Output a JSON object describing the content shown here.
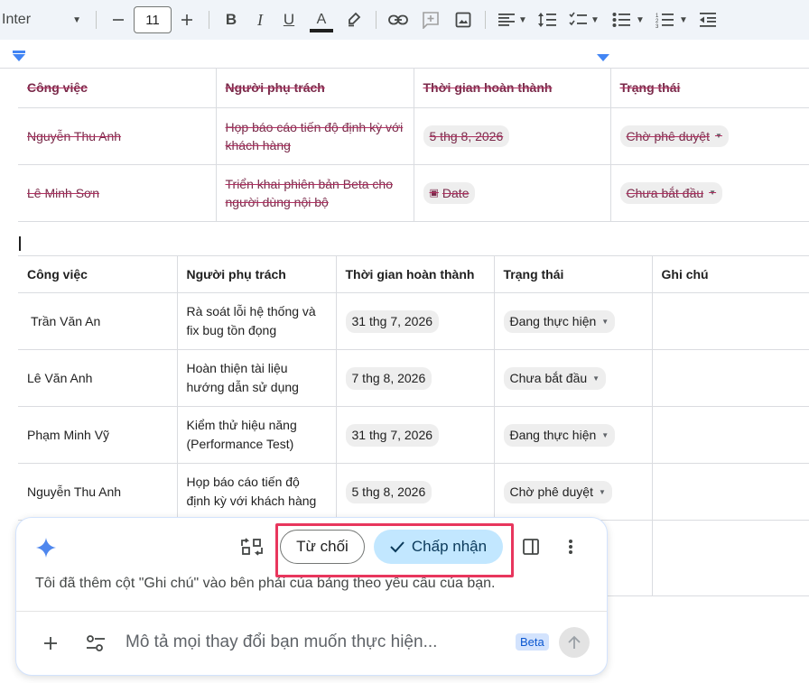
{
  "toolbar": {
    "font_name": "Inter",
    "font_size": "11",
    "icons": [
      "minus-icon",
      "plus-icon",
      "bold-icon",
      "italic-icon",
      "underline-icon",
      "text-color-icon",
      "highlight-icon",
      "link-icon",
      "comment-icon",
      "image-icon",
      "align-icon",
      "line-spacing-icon",
      "checklist-icon",
      "bullet-list-icon",
      "numbered-list-icon",
      "decrease-indent-icon"
    ],
    "bold": "B",
    "italic": "I",
    "underline": "U",
    "text_color": "A",
    "text_color_value": "#1f1f1f"
  },
  "table1": {
    "headers": [
      "Công việc",
      "Người phụ trách",
      "Thời gian hoàn thành",
      "Trạng thái"
    ],
    "rows": [
      {
        "task": "Nguyễn Thu Anh",
        "owner": "Họp báo cáo tiến độ định kỳ với khách hàng",
        "date": "5 thg 8, 2026",
        "status": "Chờ phê duyệt"
      },
      {
        "task": "Lê Minh Sơn",
        "owner": "Triển khai phiên bản Beta cho người dùng nội bộ",
        "date": "Date",
        "status": "Chưa bắt đầu"
      }
    ]
  },
  "table2": {
    "headers": [
      "Công việc",
      "Người phụ trách",
      "Thời gian hoàn thành",
      "Trạng thái",
      "Ghi chú"
    ],
    "rows": [
      {
        "task": "Trần Văn An",
        "owner": "Rà soát lỗi hệ thống và fix bug tồn đọng",
        "date": "31 thg 7, 2026",
        "status": "Đang thực hiện",
        "note": ""
      },
      {
        "task": "Lê Văn Anh",
        "owner": "Hoàn thiện tài liệu hướng dẫn sử dụng",
        "date": "7 thg 8, 2026",
        "status": "Chưa bắt đầu",
        "note": ""
      },
      {
        "task": "Phạm Minh Vỹ",
        "owner": "Kiểm thử hiệu năng (Performance Test)",
        "date": "31 thg 7, 2026",
        "status": "Đang thực hiện",
        "note": ""
      },
      {
        "task": "Nguyễn Thu Anh",
        "owner": "Họp báo cáo tiến độ định kỳ với khách hàng",
        "date": "5 thg 8, 2026",
        "status": "Chờ phê duyệt",
        "note": ""
      }
    ]
  },
  "panel": {
    "reject_label": "Từ chối",
    "accept_label": "Chấp nhận",
    "message": "Tôi đã thêm cột \"Ghi chú\" vào bên phải của bảng theo yêu cầu của bạn.",
    "prompt_placeholder": "Mô tả mọi thay đổi bạn muốn thực hiện...",
    "beta_label": "Beta",
    "accent_color": "#c2e7ff",
    "highlight_color": "#e8365d"
  }
}
